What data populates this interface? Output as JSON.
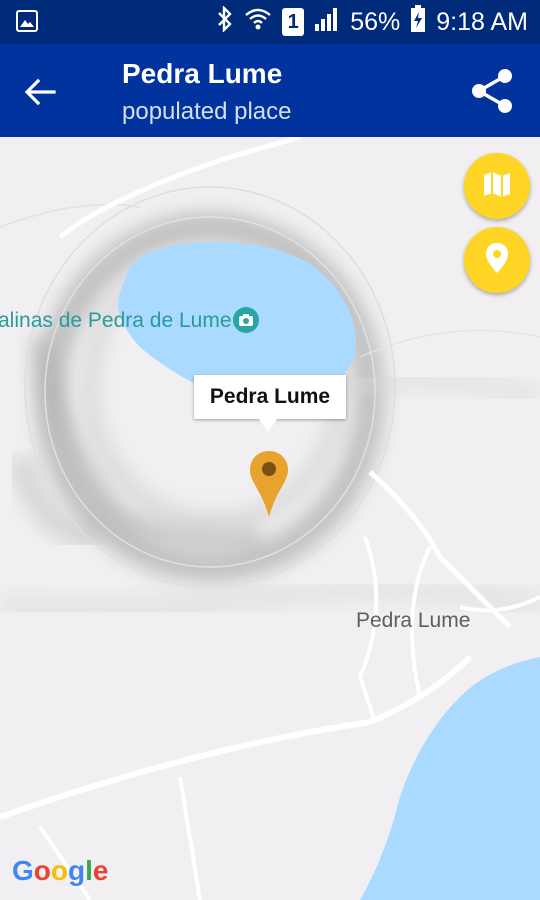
{
  "status_bar": {
    "battery": "56%",
    "time": "9:18 AM",
    "sim_slot": "1"
  },
  "app_bar": {
    "title": "Pedra Lume",
    "subtitle": "populated place"
  },
  "map": {
    "marker_callout": "Pedra Lume",
    "place_label": "Pedra Lume",
    "lake_label": "alinas de Pedra de Lume",
    "attribution": "Google"
  },
  "colors": {
    "status_bar": "#002a7a",
    "app_bar": "#00339d",
    "fab": "#ffd525",
    "marker": "#e7a32d",
    "water": "#aadaff"
  }
}
